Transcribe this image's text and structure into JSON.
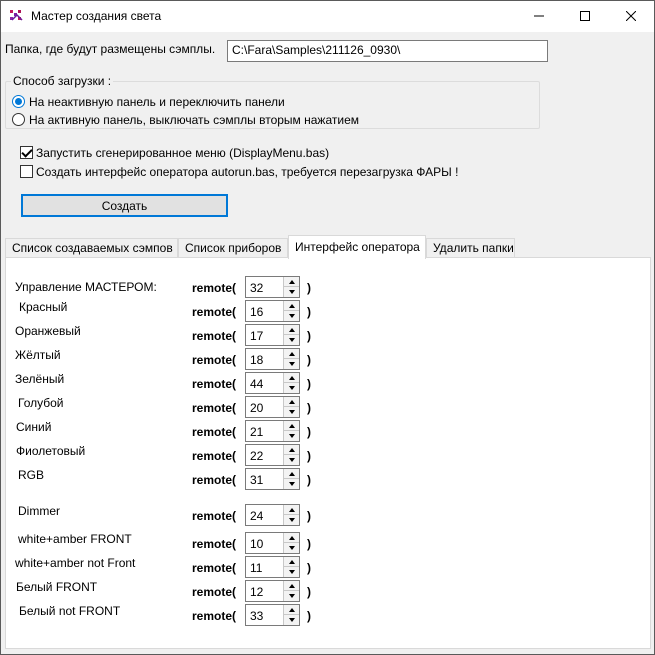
{
  "window": {
    "title": "Мастер создания света",
    "icon": "app-icon",
    "controls": {
      "minimize": "minimize-icon",
      "maximize": "maximize-icon",
      "close": "close-icon"
    }
  },
  "folder": {
    "label": "Папка, где будут размещены сэмплы.",
    "value": "C:\\Fara\\Samples\\211126_0930\\"
  },
  "load_mode": {
    "title": "Способ загрузки :",
    "options": [
      {
        "label": "На неактивную панель и переключить панели",
        "checked": true
      },
      {
        "label": "На активную панель, выключать сэмплы вторым нажатием",
        "checked": false
      }
    ]
  },
  "options": {
    "run_menu": {
      "label": "Запустить сгенерированное меню (DisplayMenu.bas)",
      "checked": true
    },
    "create_autorun": {
      "label": "Создать интерфейс оператора autorun.bas, требуется перезагрузка ФАРЫ !",
      "checked": false
    }
  },
  "create_button": "Создать",
  "tabs": [
    {
      "label": "Список создаваемых сэмпов",
      "active": false
    },
    {
      "label": "Список приборов",
      "active": false
    },
    {
      "label": "Интерфейс оператора",
      "active": true
    },
    {
      "label": "Удалить папки",
      "active": false
    }
  ],
  "operator": {
    "remote_label": "remote(",
    "close_paren": ")",
    "rows": [
      {
        "label": "Управление МАСТЕРОМ:",
        "value": "32"
      },
      {
        "label": "Красный",
        "value": "16"
      },
      {
        "label": "Оранжевый",
        "value": "17"
      },
      {
        "label": "Жёлтый",
        "value": "18"
      },
      {
        "label": "Зелёный",
        "value": "44"
      },
      {
        "label": "Голубой",
        "value": "20"
      },
      {
        "label": "Синий",
        "value": "21"
      },
      {
        "label": "Фиолетовый",
        "value": "22"
      },
      {
        "label": "RGB",
        "value": "31"
      },
      {
        "label": "Dimmer",
        "value": "24"
      },
      {
        "label": "white+amber FRONT",
        "value": "10"
      },
      {
        "label": "white+amber not Front",
        "value": "11"
      },
      {
        "label": "Белый FRONT",
        "value": "12"
      },
      {
        "label": "Белый not FRONT",
        "value": "33"
      }
    ]
  },
  "colors": {
    "accent": "#0078d7",
    "window_bg": "#f0f0f0"
  }
}
